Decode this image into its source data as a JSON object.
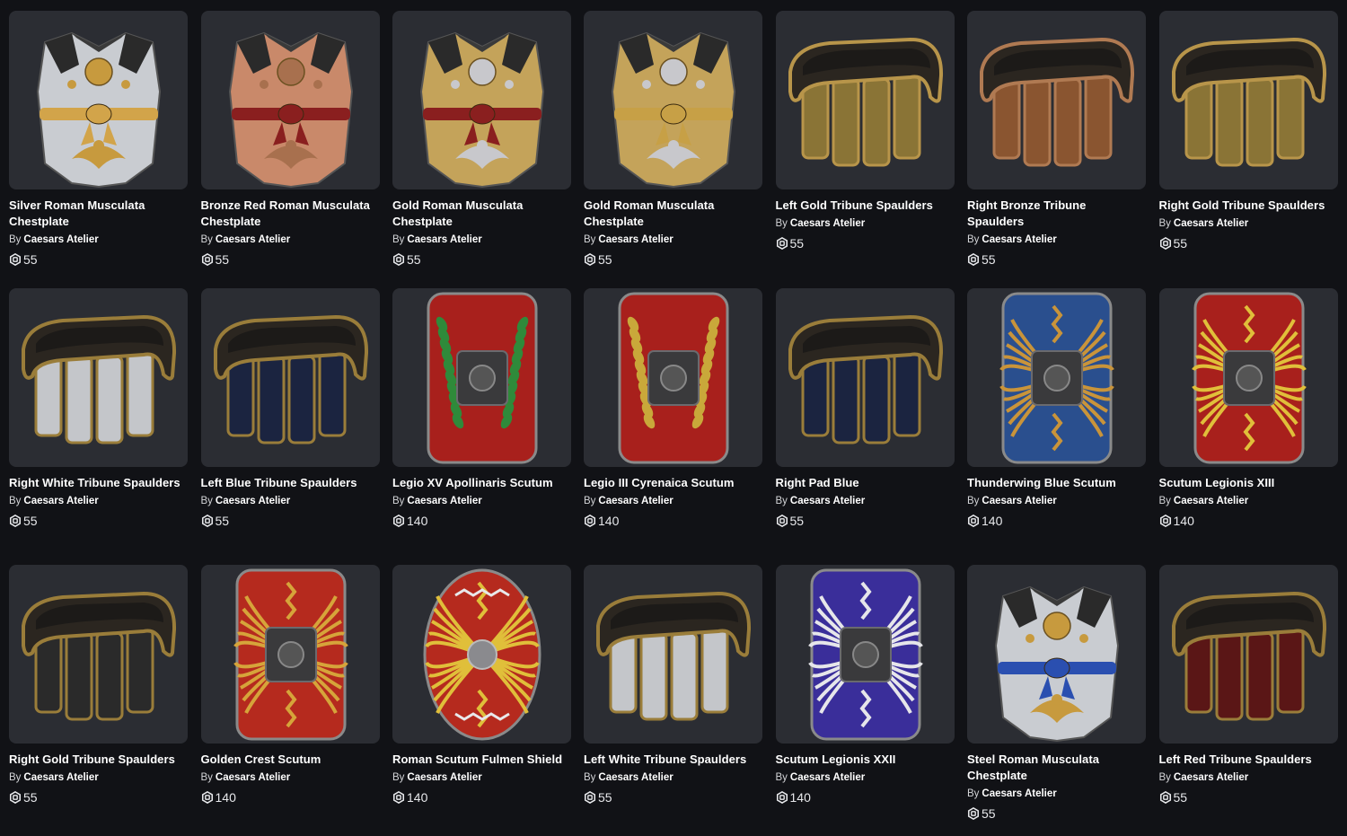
{
  "items": [
    {
      "name": "Silver Roman Musculata Chestplate",
      "by": "By",
      "creator": "Caesars Atelier",
      "price": "55",
      "kind": "chest",
      "c1": "#c9ccd1",
      "c2": "#d2a44a",
      "c3": "#c79a3e",
      "emb": "#c79a3e"
    },
    {
      "name": "Bronze Red Roman Musculata Chestplate",
      "by": "By",
      "creator": "Caesars Atelier",
      "price": "55",
      "kind": "chest",
      "c1": "#c9896a",
      "c2": "#8a1f1f",
      "c3": "#8b5a3a",
      "emb": "#a8704e"
    },
    {
      "name": "Gold Roman Musculata Chestplate",
      "by": "By",
      "creator": "Caesars Atelier",
      "price": "55",
      "kind": "chest",
      "c1": "#c4a35a",
      "c2": "#8a1f1f",
      "c3": "#8a6a2a",
      "emb": "#c8c8cc"
    },
    {
      "name": "Gold Roman Musculata Chestplate",
      "by": "By",
      "creator": "Caesars Atelier",
      "price": "55",
      "kind": "chest",
      "c1": "#c4a35a",
      "c2": "#c7a046",
      "c3": "#8a6a2a",
      "emb": "#c8c8cc"
    },
    {
      "name": "Left Gold Tribune Spaulders",
      "by": "By",
      "creator": "Caesars Atelier",
      "price": "55",
      "kind": "spaulder",
      "c1": "#8a7436",
      "c2": "#b8954a"
    },
    {
      "name": "Right Bronze Tribune Spaulders",
      "by": "By",
      "creator": "Caesars Atelier",
      "price": "55",
      "kind": "spaulder",
      "c1": "#8a5530",
      "c2": "#b07a52"
    },
    {
      "name": "Right Gold Tribune Spaulders",
      "by": "By",
      "creator": "Caesars Atelier",
      "price": "55",
      "kind": "spaulder",
      "c1": "#8a7436",
      "c2": "#b8954a"
    },
    {
      "name": "Right White Tribune Spaulders",
      "by": "By",
      "creator": "Caesars Atelier",
      "price": "55",
      "kind": "spaulder",
      "c1": "#c4c6ca",
      "c2": "#9a7d3a"
    },
    {
      "name": "Left Blue Tribune Spaulders",
      "by": "By",
      "creator": "Caesars Atelier",
      "price": "55",
      "kind": "spaulder",
      "c1": "#1b2440",
      "c2": "#9a7d3a"
    },
    {
      "name": "Legio XV Apollinaris Scutum",
      "by": "By",
      "creator": "Caesars Atelier",
      "price": "140",
      "kind": "scutum",
      "c1": "#a8201c",
      "c2": "#2f8a3a",
      "emb": "wreath"
    },
    {
      "name": "Legio III Cyrenaica Scutum",
      "by": "By",
      "creator": "Caesars Atelier",
      "price": "140",
      "kind": "scutum",
      "c1": "#a8201c",
      "c2": "#c9a83a",
      "emb": "wreath"
    },
    {
      "name": "Right Pad Blue",
      "by": "By",
      "creator": "Caesars Atelier",
      "price": "55",
      "kind": "spaulder",
      "c1": "#1b2440",
      "c2": "#9a7d3a"
    },
    {
      "name": "Thunderwing Blue Scutum",
      "by": "By",
      "creator": "Caesars Atelier",
      "price": "140",
      "kind": "scutum",
      "c1": "#2a4f8e",
      "c2": "#c9943a",
      "emb": "wings"
    },
    {
      "name": "Scutum Legionis XIII",
      "by": "By",
      "creator": "Caesars Atelier",
      "price": "140",
      "kind": "scutum",
      "c1": "#a8201c",
      "c2": "#e0bf3a",
      "emb": "wings"
    },
    {
      "name": "Right Gold Tribune Spaulders",
      "by": "By",
      "creator": "Caesars Atelier",
      "price": "55",
      "kind": "spaulder",
      "c1": "#2a2a2a",
      "c2": "#9a7d3a"
    },
    {
      "name": "Golden Crest Scutum",
      "by": "By",
      "creator": "Caesars Atelier",
      "price": "140",
      "kind": "scutum",
      "c1": "#b52a1e",
      "c2": "#d6a43a",
      "emb": "wings"
    },
    {
      "name": "Roman Scutum Fulmen Shield",
      "by": "By",
      "creator": "Caesars Atelier",
      "price": "140",
      "kind": "oval",
      "c1": "#b52a1e",
      "c2": "#e0bf3a",
      "emb": "fulmen"
    },
    {
      "name": "Left White Tribune Spaulders",
      "by": "By",
      "creator": "Caesars Atelier",
      "price": "55",
      "kind": "spaulder",
      "c1": "#c4c6ca",
      "c2": "#9a7d3a"
    },
    {
      "name": "Scutum Legionis XXII",
      "by": "By",
      "creator": "Caesars Atelier",
      "price": "140",
      "kind": "scutum",
      "c1": "#3a2e9a",
      "c2": "#e6e6ea",
      "emb": "wings"
    },
    {
      "name": "Steel Roman Musculata Chestplate",
      "by": "By",
      "creator": "Caesars Atelier",
      "price": "55",
      "kind": "chest",
      "c1": "#c9ccd1",
      "c2": "#2a4fb0",
      "c3": "#9a9ca2",
      "emb": "#c79a3e"
    },
    {
      "name": "Left Red Tribune Spaulders",
      "by": "By",
      "creator": "Caesars Atelier",
      "price": "55",
      "kind": "spaulder",
      "c1": "#5a1616",
      "c2": "#9a7d3a"
    }
  ]
}
